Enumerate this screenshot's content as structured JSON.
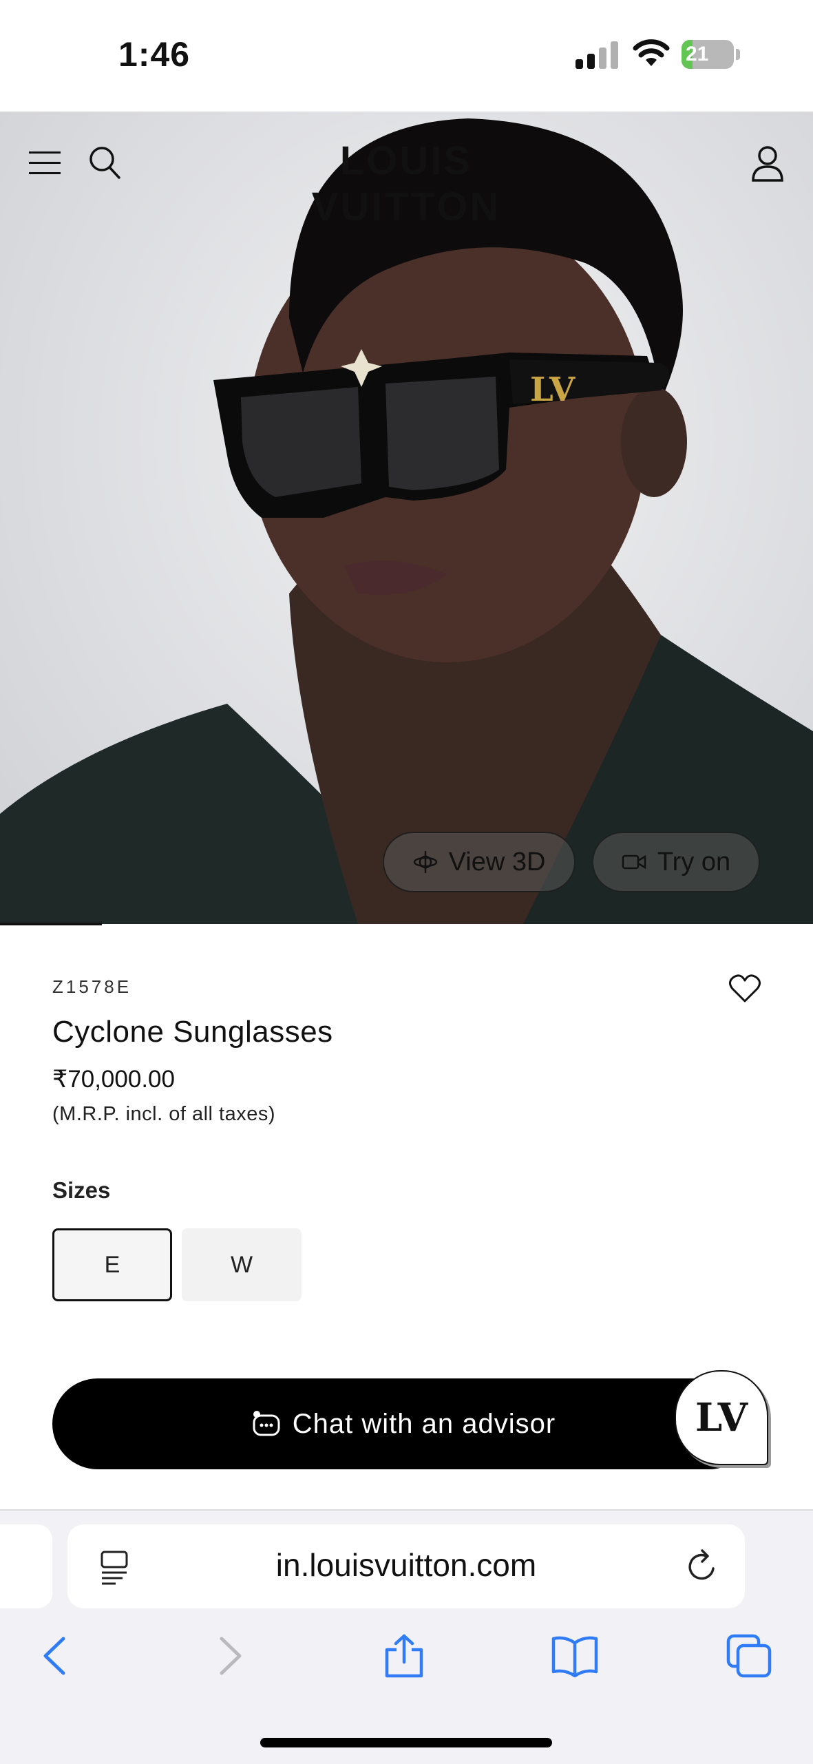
{
  "status_bar": {
    "time": "1:46",
    "battery_level": "21",
    "battery_fraction": 0.21
  },
  "header": {
    "brand": "LOUIS VUITTON"
  },
  "hero": {
    "view_3d_label": "View 3D",
    "try_on_label": "Try on"
  },
  "product": {
    "sku": "Z1578E",
    "name": "Cyclone Sunglasses",
    "price": "₹70,000.00",
    "price_note": "(M.R.P. incl. of all taxes)",
    "sizes_label": "Sizes",
    "sizes": [
      {
        "label": "E",
        "selected": true
      },
      {
        "label": "W",
        "selected": false
      }
    ]
  },
  "chat": {
    "label": "Chat with an advisor",
    "bubble_logo": "LV"
  },
  "browser": {
    "url": "in.louisvuitton.com"
  },
  "colors": {
    "accent": "#000000",
    "battery_green": "#62c554",
    "ios_blue": "#2f7cf6"
  },
  "icons": [
    "menu-icon",
    "search-icon",
    "account-icon",
    "view-3d-icon",
    "camera-icon",
    "heart-icon",
    "chat-icon",
    "reader-icon",
    "reload-icon",
    "back-icon",
    "forward-icon",
    "share-icon",
    "bookmarks-icon",
    "tabs-icon"
  ]
}
